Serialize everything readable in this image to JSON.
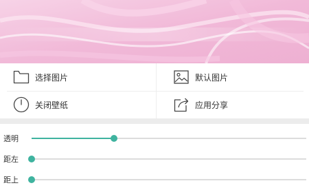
{
  "wallpaper": {
    "icon": "wallpaper-preview-image"
  },
  "actions": {
    "select_image": {
      "label": "选择图片",
      "icon": "folder-icon"
    },
    "default_image": {
      "label": "默认图片",
      "icon": "image-icon"
    },
    "close_wallpaper": {
      "label": "关闭壁纸",
      "icon": "power-icon"
    },
    "share_app": {
      "label": "应用分享",
      "icon": "share-icon"
    }
  },
  "sliders": {
    "opacity": {
      "label": "透明",
      "value": 0.3
    },
    "left_offset": {
      "label": "距左",
      "value": 0.0
    },
    "top_offset": {
      "label": "距上",
      "value": 0.0
    }
  },
  "colors": {
    "accent": "#3fb39f",
    "track": "#dcdcdc",
    "wallpaper_pink": "#f2bedc"
  }
}
